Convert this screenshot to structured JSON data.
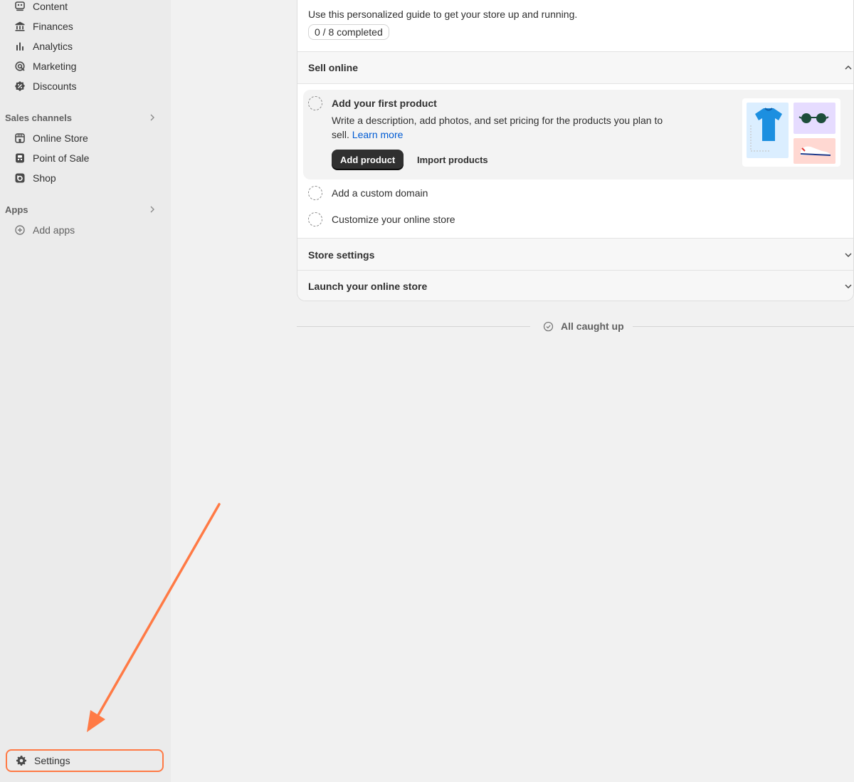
{
  "sidebar": {
    "items": [
      {
        "label": "Content",
        "icon": "content-icon"
      },
      {
        "label": "Finances",
        "icon": "bank-icon"
      },
      {
        "label": "Analytics",
        "icon": "bar-chart-icon"
      },
      {
        "label": "Marketing",
        "icon": "target-icon"
      },
      {
        "label": "Discounts",
        "icon": "discount-icon"
      }
    ],
    "sales_channels_label": "Sales channels",
    "channels": [
      {
        "label": "Online Store",
        "icon": "store-icon"
      },
      {
        "label": "Point of Sale",
        "icon": "pos-icon"
      },
      {
        "label": "Shop",
        "icon": "shop-icon"
      }
    ],
    "apps_label": "Apps",
    "add_apps_label": "Add apps",
    "settings_label": "Settings"
  },
  "guide": {
    "description": "Use this personalized guide to get your store up and running.",
    "progress": "0 / 8 completed",
    "sections": {
      "sell_online": "Sell online",
      "store_settings": "Store settings",
      "launch": "Launch your online store"
    },
    "tasks": {
      "first_product": {
        "title": "Add your first product",
        "body": "Write a description, add photos, and set pricing for the products you plan to sell.",
        "link": "Learn more",
        "primary_button": "Add product",
        "secondary_button": "Import products"
      },
      "custom_domain": "Add a custom domain",
      "customize_store": "Customize your online store"
    }
  },
  "feed": {
    "caught_up": "All caught up"
  },
  "colors": {
    "highlight": "#ff7a45",
    "primary_button": "#303030",
    "link": "#005bd3"
  }
}
